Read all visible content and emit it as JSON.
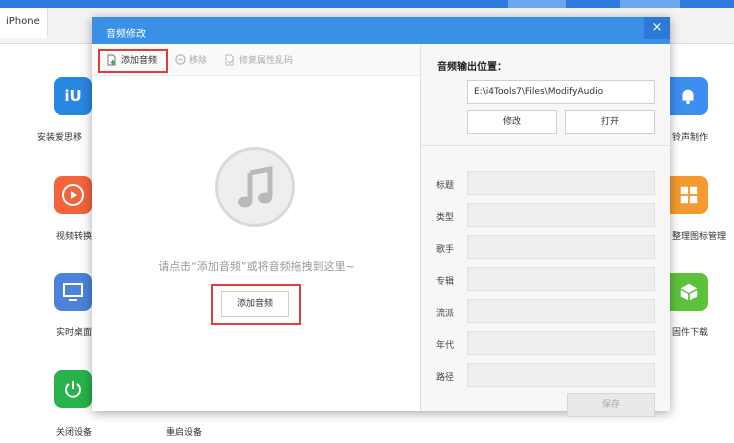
{
  "app": {
    "tab_label": "iPhone",
    "tiles": [
      {
        "name": "i4-app-tile",
        "label": "安装爱思移",
        "color": "#2a86e3",
        "icon": "i4-logo-icon"
      },
      {
        "name": "ringtone-tile",
        "label": "铃声制作",
        "color": "#3c8ff0",
        "icon": "bell-icon"
      },
      {
        "name": "video-convert-tile",
        "label": "视频转换",
        "color": "#f2643b",
        "icon": "play-icon"
      },
      {
        "name": "icon-manage-tile",
        "label": "整理图标管理",
        "color": "#f59a30",
        "icon": "grid-icon"
      },
      {
        "name": "realtime-desktop-tile",
        "label": "实时桌面",
        "color": "#4a83d9",
        "icon": "monitor-icon"
      },
      {
        "name": "firmware-download-tile",
        "label": "固件下载",
        "color": "#5cc23a",
        "icon": "box-icon"
      },
      {
        "name": "shutdown-tile",
        "label": "关闭设备",
        "color": "#27b24a",
        "icon": "power-icon"
      },
      {
        "name": "reboot-tile",
        "label": "重启设备",
        "color": "#5bb833",
        "icon": "reboot-icon"
      }
    ]
  },
  "dialog": {
    "title": "音频修改",
    "close_glyph": "×",
    "toolbar": {
      "add_label": "添加音频",
      "remove_label": "移除",
      "fix_label": "修复属性乱码"
    },
    "empty": {
      "icon": "music-note-icon",
      "hint": "请点击“添加音频”或将音频拖拽到这里~",
      "add_button": "添加音频"
    },
    "output": {
      "label": "音频输出位置：",
      "path": "E:\\i4Tools7\\Files\\ModifyAudio",
      "modify_button": "修改",
      "open_button": "打开"
    },
    "fields": [
      {
        "label": "标题",
        "value": ""
      },
      {
        "label": "类型",
        "value": ""
      },
      {
        "label": "歌手",
        "value": ""
      },
      {
        "label": "专辑",
        "value": ""
      },
      {
        "label": "流派",
        "value": ""
      },
      {
        "label": "年代",
        "value": ""
      },
      {
        "label": "路径",
        "value": ""
      }
    ],
    "save_button": "保存"
  },
  "colors": {
    "accent": "#3a8fe6",
    "highlight": "#e23b3b"
  }
}
